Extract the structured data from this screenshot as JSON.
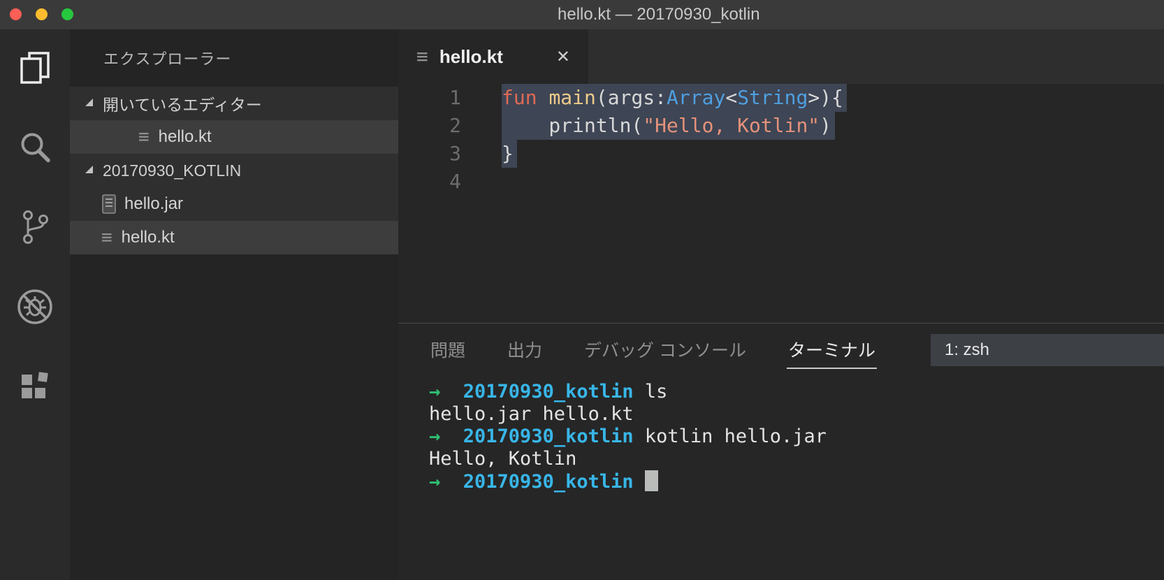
{
  "window": {
    "title": "hello.kt — 20170930_kotlin"
  },
  "activity_bar": {
    "items": [
      {
        "id": "explorer",
        "icon": "files-icon",
        "active": true
      },
      {
        "id": "search",
        "icon": "search-icon",
        "active": false
      },
      {
        "id": "source-control",
        "icon": "git-branch-icon",
        "active": false
      },
      {
        "id": "debug",
        "icon": "debug-disabled-icon",
        "active": false
      },
      {
        "id": "extensions",
        "icon": "extensions-icon",
        "active": false
      }
    ]
  },
  "sidebar": {
    "title": "エクスプローラー",
    "rows": [
      {
        "type": "section",
        "label": "開いているエディター",
        "expanded": true
      },
      {
        "type": "file",
        "label": "hello.kt",
        "icon": "kt-file-icon",
        "indent": "open-editor",
        "selected": true
      },
      {
        "type": "section",
        "label": "20170930_KOTLIN",
        "expanded": true
      },
      {
        "type": "file",
        "label": "hello.jar",
        "icon": "jar-file-icon",
        "indent": "folder-file",
        "selected": false
      },
      {
        "type": "file",
        "label": "hello.kt",
        "icon": "kt-file-icon",
        "indent": "folder-file",
        "selected": true
      }
    ]
  },
  "editor": {
    "tab": {
      "label": "hello.kt",
      "close_glyph": "✕"
    },
    "code": {
      "lines": [
        {
          "number": "1",
          "selected": true,
          "tokens": [
            [
              "keyword",
              "fun "
            ],
            [
              "function",
              "main"
            ],
            [
              "punct",
              "("
            ],
            [
              "plain",
              "args"
            ],
            [
              "punct",
              ":"
            ],
            [
              "type",
              "Array"
            ],
            [
              "punct",
              "<"
            ],
            [
              "type",
              "String"
            ],
            [
              "punct",
              ">){"
            ]
          ]
        },
        {
          "number": "2",
          "selected": true,
          "tokens": [
            [
              "plain",
              "    println("
            ],
            [
              "string",
              "\"Hello, Kotlin\""
            ],
            [
              "plain",
              ")"
            ]
          ]
        },
        {
          "number": "3",
          "selected": true,
          "tokens": [
            [
              "plain",
              "}"
            ]
          ]
        },
        {
          "number": "4",
          "selected": false,
          "tokens": []
        }
      ]
    }
  },
  "panel": {
    "tabs": [
      {
        "label": "問題",
        "active": false
      },
      {
        "label": "出力",
        "active": false
      },
      {
        "label": "デバッグ コンソール",
        "active": false
      },
      {
        "label": "ターミナル",
        "active": true
      }
    ],
    "shell_select": {
      "value": "1: zsh"
    },
    "terminal": {
      "lines": [
        {
          "tokens": [
            [
              "prompt",
              "→  "
            ],
            [
              "cwd",
              "20170930_kotlin"
            ],
            [
              "cmd",
              " ls"
            ]
          ],
          "cursor": false
        },
        {
          "tokens": [
            [
              "out",
              "hello.jar hello.kt"
            ]
          ],
          "cursor": false
        },
        {
          "tokens": [
            [
              "prompt",
              "→  "
            ],
            [
              "cwd",
              "20170930_kotlin"
            ],
            [
              "cmd",
              " kotlin hello.jar"
            ]
          ],
          "cursor": false
        },
        {
          "tokens": [
            [
              "out",
              "Hello, Kotlin"
            ]
          ],
          "cursor": false
        },
        {
          "tokens": [
            [
              "prompt",
              "→  "
            ],
            [
              "cwd",
              "20170930_kotlin"
            ],
            [
              "cmd",
              " "
            ]
          ],
          "cursor": true
        }
      ]
    }
  },
  "colors": {
    "keyword": "#e06a55",
    "function": "#eecb8b",
    "type": "#4f9fe0",
    "string": "#e5927a",
    "prompt_green": "#2fbf71",
    "cwd_cyan": "#38b6e8",
    "selection": "#3e4554"
  }
}
